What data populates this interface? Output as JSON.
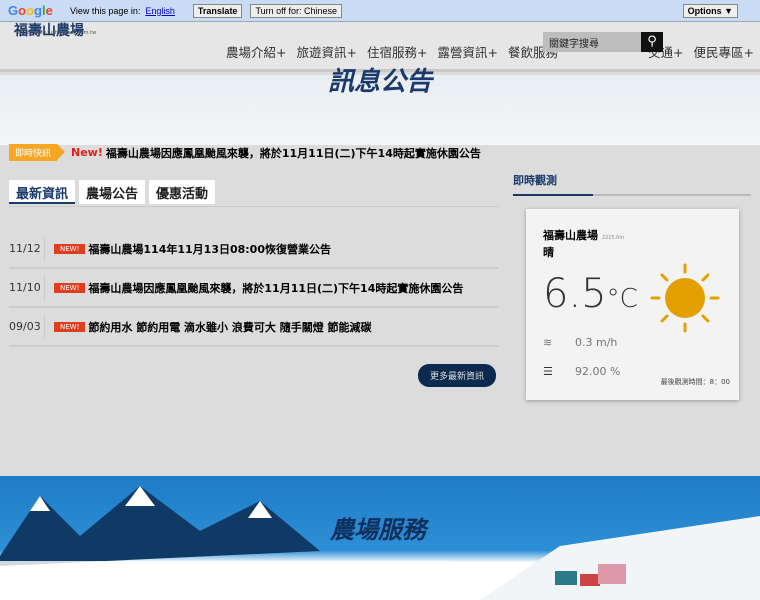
{
  "translate_bar": {
    "brand": "Google",
    "prompt": "View this page in:",
    "language": "English",
    "translate": "Translate",
    "turn_off": "Turn off for: Chinese",
    "options": "Options ▼"
  },
  "header": {
    "logo": "福壽山農場",
    "logo_url": "https://www.fushoushan.com.tw",
    "search_placeholder": "關鍵字搜尋",
    "nav": [
      "農場介紹+",
      "旅遊資訊+",
      "住宿服務+",
      "露營資訊+",
      "餐飲服務",
      "",
      "交通+",
      "便民專區+"
    ]
  },
  "hero": {
    "title": "訊息公告"
  },
  "ticker": {
    "tag": "即時快訊",
    "new": "New!",
    "text": "福壽山農場因應鳳凰颱風來襲，將於11月11日(二)下午14時起實施休園公告"
  },
  "tabs": [
    "最新資訊",
    "農場公告",
    "優惠活動"
  ],
  "news": [
    {
      "date": "11/12",
      "badge": "NEW!",
      "title": "福壽山農場114年11月13日08:00恢復營業公告"
    },
    {
      "date": "11/10",
      "badge": "NEW!",
      "title": "福壽山農場因應鳳凰颱風來襲，將於11月11日(二)下午14時起實施休園公告"
    },
    {
      "date": "09/03",
      "badge": "NEW!",
      "title": "節約用水 節約用電 滴水雖小 浪費可大 隨手關燈 節能減碳"
    }
  ],
  "more": "更多最新資訊",
  "weather": {
    "title": "即時觀測",
    "location": "福壽山農場",
    "elevation": "2215.0m",
    "condition": "晴",
    "temp": "6.5",
    "unit": "°C",
    "wind": "0.3 m/h",
    "humidity": "92.00 %",
    "observed": "最後觀測時間：8：00",
    "icon": "sun-icon"
  },
  "banner": {
    "title": "農場服務"
  }
}
